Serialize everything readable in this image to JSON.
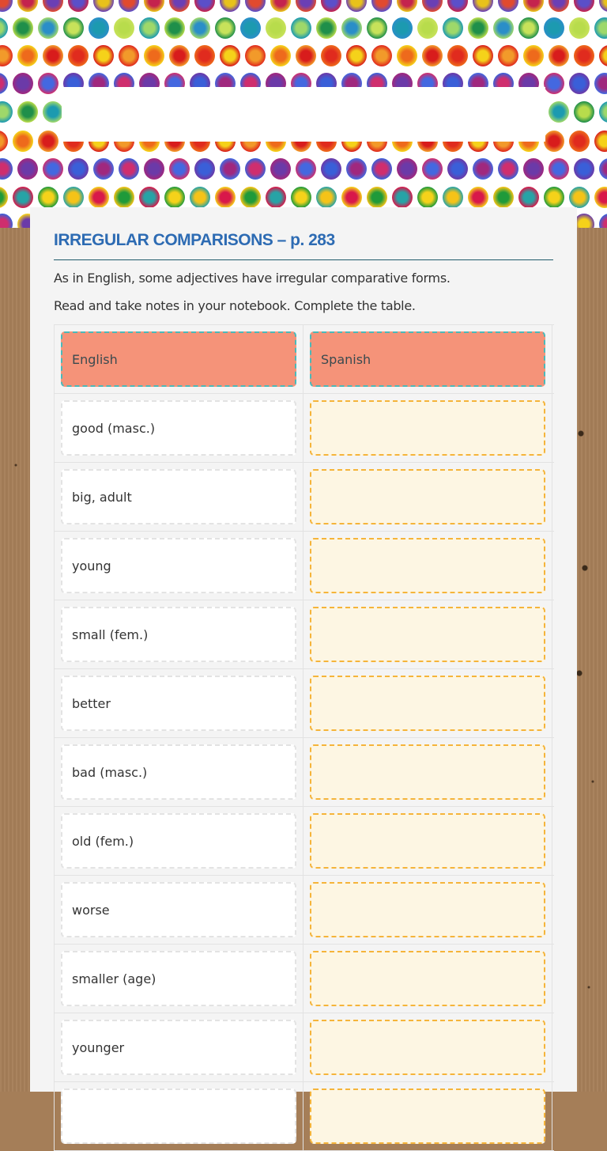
{
  "header": {
    "title": "IRREGULAR COMPARISONS – p. 283"
  },
  "intro": {
    "line1": "As in English, some adjectives have  irregular comparative forms.",
    "line2": "Read and take notes in your notebook. Complete the table."
  },
  "table": {
    "headers": [
      "English",
      "Spanish"
    ],
    "rows": [
      {
        "english": "good (masc.)",
        "spanish": ""
      },
      {
        "english": "big, adult",
        "spanish": ""
      },
      {
        "english": "young",
        "spanish": ""
      },
      {
        "english": "small (fem.)",
        "spanish": ""
      },
      {
        "english": "better",
        "spanish": ""
      },
      {
        "english": "bad (masc.)",
        "spanish": ""
      },
      {
        "english": "old (fem.)",
        "spanish": ""
      },
      {
        "english": "worse",
        "spanish": ""
      },
      {
        "english": "smaller (age)",
        "spanish": ""
      },
      {
        "english": "younger",
        "spanish": ""
      },
      {
        "english": "",
        "spanish": ""
      }
    ]
  },
  "colors": {
    "title": "#2d6bb3",
    "header_fill": "#f59379",
    "header_border": "#4bb9b9",
    "answer_fill": "#fdf6e3",
    "answer_border": "#f5b43a"
  }
}
